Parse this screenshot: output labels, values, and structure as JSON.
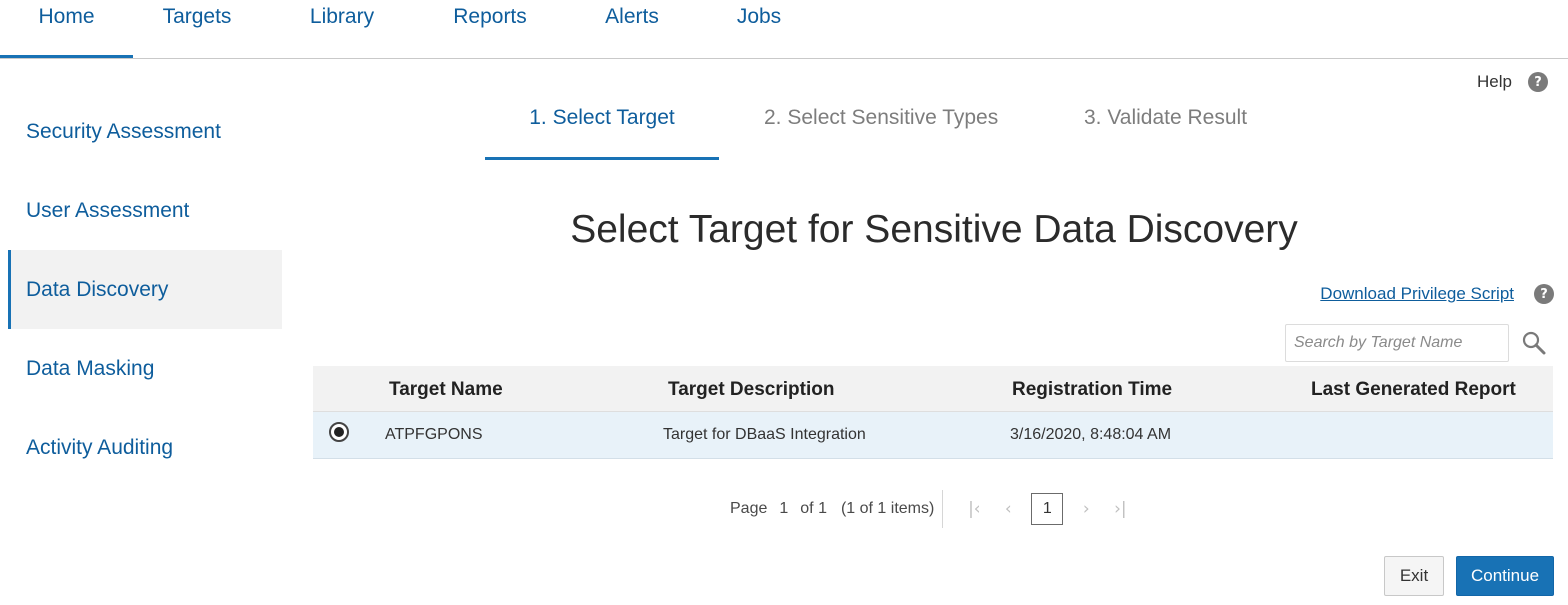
{
  "topnav": {
    "tabs": [
      {
        "label": "Home",
        "active": true
      },
      {
        "label": "Targets"
      },
      {
        "label": "Library"
      },
      {
        "label": "Reports"
      },
      {
        "label": "Alerts"
      },
      {
        "label": "Jobs"
      }
    ]
  },
  "help": {
    "label": "Help",
    "icon": "question-circle-icon"
  },
  "sidebar": {
    "items": [
      {
        "label": "Security Assessment"
      },
      {
        "label": "User Assessment"
      },
      {
        "label": "Data Discovery",
        "active": true
      },
      {
        "label": "Data Masking"
      },
      {
        "label": "Activity Auditing"
      }
    ]
  },
  "wizard": {
    "steps": [
      {
        "label": "1. Select Target",
        "active": true
      },
      {
        "label": "2. Select Sensitive Types"
      },
      {
        "label": "3. Validate Result"
      }
    ]
  },
  "page_title": "Select Target for Sensitive Data Discovery",
  "download": {
    "label": "Download Privilege Script",
    "help_icon": "question-circle-icon"
  },
  "search": {
    "placeholder": "Search by Target Name",
    "value": "",
    "icon": "search-icon"
  },
  "table": {
    "columns": [
      "Target Name",
      "Target Description",
      "Registration Time",
      "Last Generated Report"
    ],
    "rows": [
      {
        "selected": true,
        "name": "ATPFGPONS",
        "description": "Target for DBaaS Integration",
        "registration_time": "3/16/2020, 8:48:04 AM",
        "last_report": ""
      }
    ]
  },
  "pagination": {
    "page_label": "Page",
    "current_page": "1",
    "of_label": "of 1",
    "items_label": "(1 of 1 items)",
    "current_button": "1"
  },
  "actions": {
    "exit_label": "Exit",
    "continue_label": "Continue"
  },
  "colors": {
    "accent": "#1872b5",
    "link": "#0e5d9c",
    "row_selected": "#e8f2f9",
    "header_bg": "#f2f2f2"
  }
}
